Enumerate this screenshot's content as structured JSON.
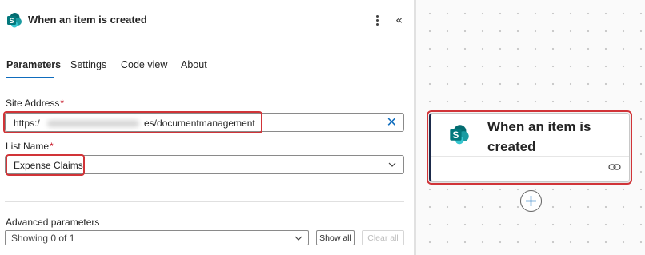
{
  "header": {
    "title": "When an item is created",
    "logo_icon": "sharepoint-icon",
    "more_icon": "more-vertical-icon",
    "collapse_icon": "double-chevron-left-icon",
    "collapse_glyph": "«"
  },
  "tabs": [
    {
      "label": "Parameters",
      "active": true
    },
    {
      "label": "Settings",
      "active": false
    },
    {
      "label": "Code view",
      "active": false
    },
    {
      "label": "About",
      "active": false
    }
  ],
  "site_address": {
    "label": "Site Address",
    "required_mark": "*",
    "value_start": "https:/",
    "value_end": "es/documentmanagement",
    "clear_glyph": "✕"
  },
  "list_name": {
    "label": "List Name",
    "required_mark": "*",
    "value": "Expense Claims"
  },
  "advanced": {
    "label": "Advanced parameters",
    "select_value": "Showing 0 of 1",
    "show_all_label": "Show all",
    "clear_all_label": "Clear all"
  },
  "canvas": {
    "card_title": "When an item is created",
    "card_icon": "sharepoint-icon",
    "link_icon": "link-icon",
    "add_icon": "plus-icon"
  },
  "colors": {
    "accent": "#0f6cbd",
    "highlight": "#d13438",
    "sharepoint_teal": "#03787c",
    "card_border_left": "#1b2a4a"
  }
}
